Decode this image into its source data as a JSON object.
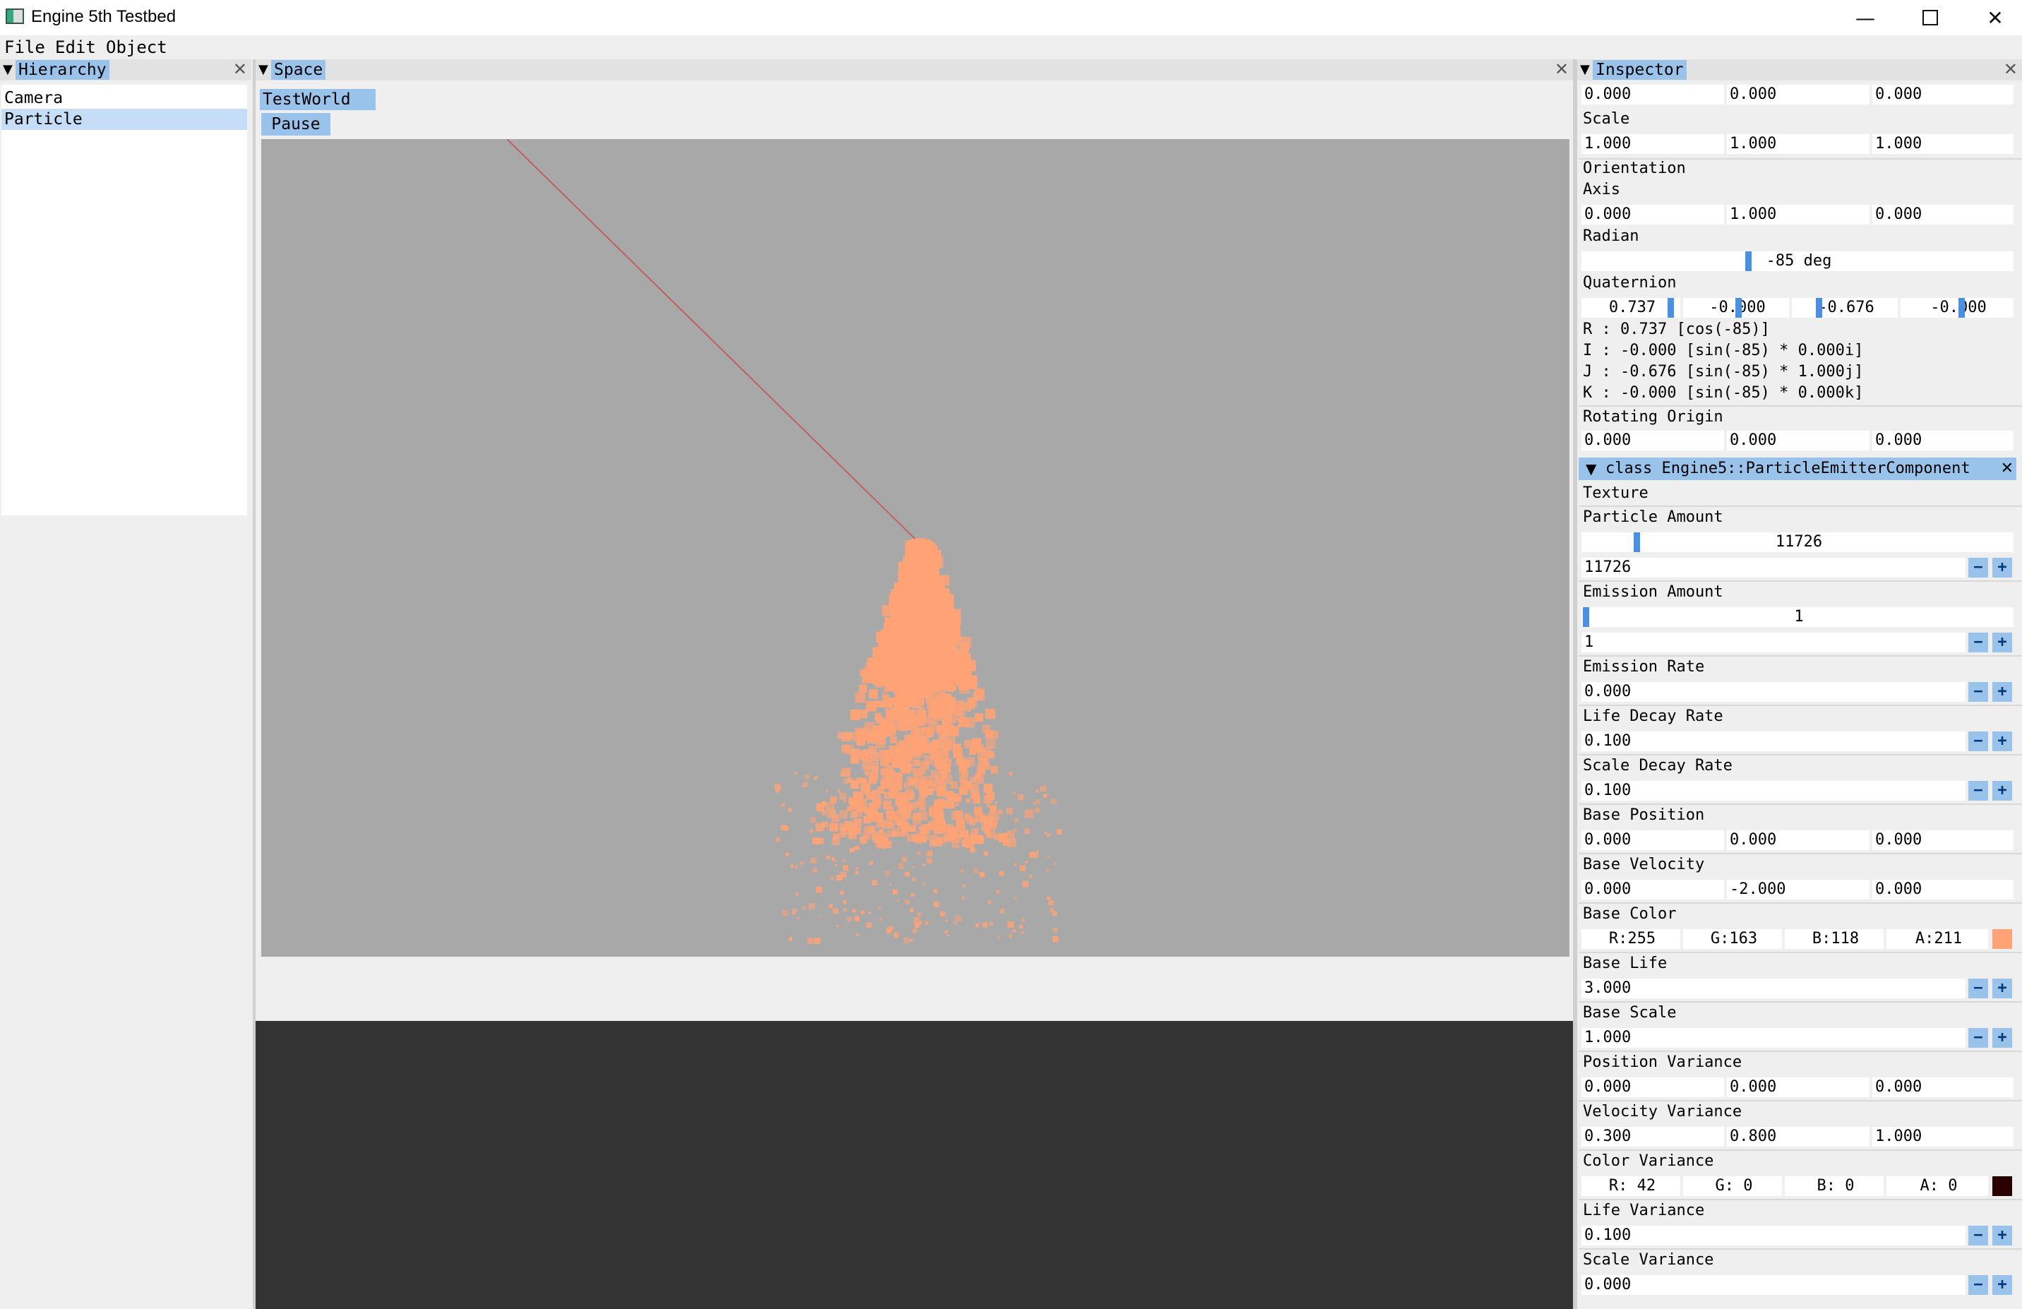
{
  "window": {
    "title": "Engine 5th Testbed",
    "min_icon": "minimize-icon",
    "max_icon": "maximize-icon",
    "close_icon": "close-icon",
    "close_glyph": "✕",
    "min_glyph": "—"
  },
  "menu": [
    "File",
    "Edit",
    "Object"
  ],
  "hierarchy": {
    "title": "Hierarchy",
    "items": [
      "Camera",
      "Particle"
    ],
    "selected": "Particle",
    "close_glyph": "✕"
  },
  "space": {
    "title": "Space",
    "world_tab": "TestWorld",
    "pause_label": "Pause",
    "viewport_color": "#a8a8a8",
    "particle_color": "#ffa376",
    "ray_color": "#c06060",
    "close_glyph": "✕"
  },
  "inspector": {
    "title": "Inspector",
    "position": [
      "0.000",
      "0.000",
      "0.000"
    ],
    "scale_label": "Scale",
    "scale": [
      "1.000",
      "1.000",
      "1.000"
    ],
    "orientation_label": "Orientation",
    "axis_label": "Axis",
    "axis": [
      "0.000",
      "1.000",
      "0.000"
    ],
    "radian_label": "Radian",
    "radian_value": "-85 deg",
    "quaternion_label": "Quaternion",
    "quaternion": [
      "0.737",
      "-0.000",
      "-0.676",
      "-0.000"
    ],
    "q_lines": [
      "R : 0.737 [cos(-85)]",
      "I : -0.000 [sin(-85) * 0.000i]",
      "J : -0.676 [sin(-85) * 1.000j]",
      "K : -0.000 [sin(-85) * 0.000k]"
    ],
    "rotating_origin_label": "Rotating Origin",
    "rotating_origin": [
      "0.000",
      "0.000",
      "0.000"
    ],
    "component": {
      "title": "class Engine5::ParticleEmitterComponent",
      "texture_label": "Texture",
      "particle_amount_label": "Particle Amount",
      "particle_amount_slider": "11726",
      "particle_amount_input": "11726",
      "emission_amount_label": "Emission Amount",
      "emission_amount_slider": "1",
      "emission_amount_input": "1",
      "emission_rate_label": "Emission Rate",
      "emission_rate": "0.000",
      "life_decay_label": "Life Decay Rate",
      "life_decay": "0.100",
      "scale_decay_label": "Scale Decay Rate",
      "scale_decay": "0.100",
      "base_position_label": "Base Position",
      "base_position": [
        "0.000",
        "0.000",
        "0.000"
      ],
      "base_velocity_label": "Base Velocity",
      "base_velocity": [
        "0.000",
        "-2.000",
        "0.000"
      ],
      "base_color_label": "Base Color",
      "base_color": [
        "R:255",
        "G:163",
        "B:118",
        "A:211"
      ],
      "base_color_hex": "#ffa376",
      "base_life_label": "Base Life",
      "base_life": "3.000",
      "base_scale_label": "Base Scale",
      "base_scale": "1.000",
      "position_variance_label": "Position Variance",
      "position_variance": [
        "0.000",
        "0.000",
        "0.000"
      ],
      "velocity_variance_label": "Velocity Variance",
      "velocity_variance": [
        "0.300",
        "0.800",
        "1.000"
      ],
      "color_variance_label": "Color Variance",
      "color_variance": [
        "R: 42",
        "G:  0",
        "B:  0",
        "A:  0"
      ],
      "color_variance_hex": "#2a0000",
      "life_variance_label": "Life Variance",
      "life_variance": "0.100",
      "scale_variance_label": "Scale Variance",
      "scale_variance": "0.000",
      "minus": "−",
      "plus": "+"
    }
  }
}
